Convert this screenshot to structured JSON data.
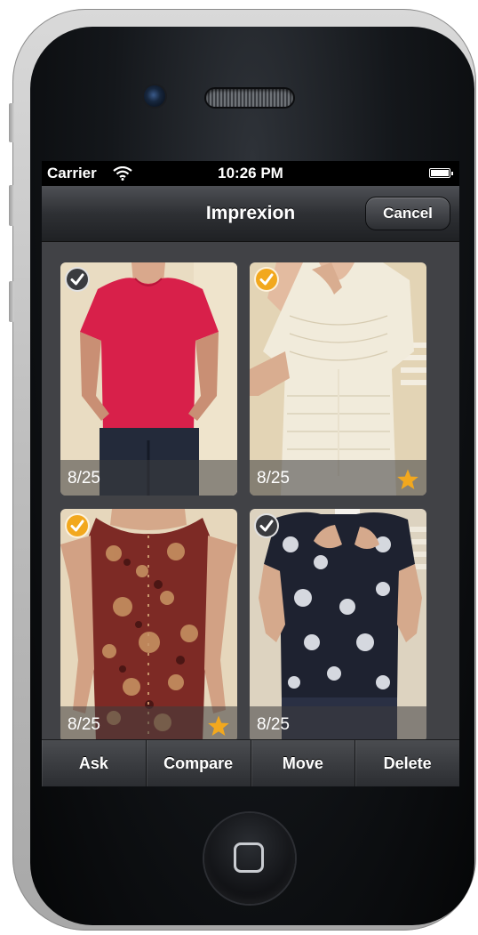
{
  "status_bar": {
    "carrier": "Carrier",
    "time": "10:26 PM"
  },
  "nav": {
    "title": "Imprexion",
    "cancel_label": "Cancel"
  },
  "photos": [
    {
      "date": "8/25",
      "selected": true,
      "check_style": "dark",
      "starred": false,
      "description": "pink short-sleeve top"
    },
    {
      "date": "8/25",
      "selected": true,
      "check_style": "gold",
      "starred": true,
      "description": "white crochet lace top"
    },
    {
      "date": "8/25",
      "selected": true,
      "check_style": "gold",
      "starred": true,
      "description": "paisley sleeveless blouse"
    },
    {
      "date": "8/25",
      "selected": true,
      "check_style": "dark",
      "starred": false,
      "description": "black floral print top"
    }
  ],
  "toolbar": {
    "ask_label": "Ask",
    "compare_label": "Compare",
    "move_label": "Move",
    "delete_label": "Delete"
  },
  "colors": {
    "accent_gold": "#f2a81e",
    "toolbar_dark": "#2b2d31",
    "screen_bg": "#414246"
  }
}
